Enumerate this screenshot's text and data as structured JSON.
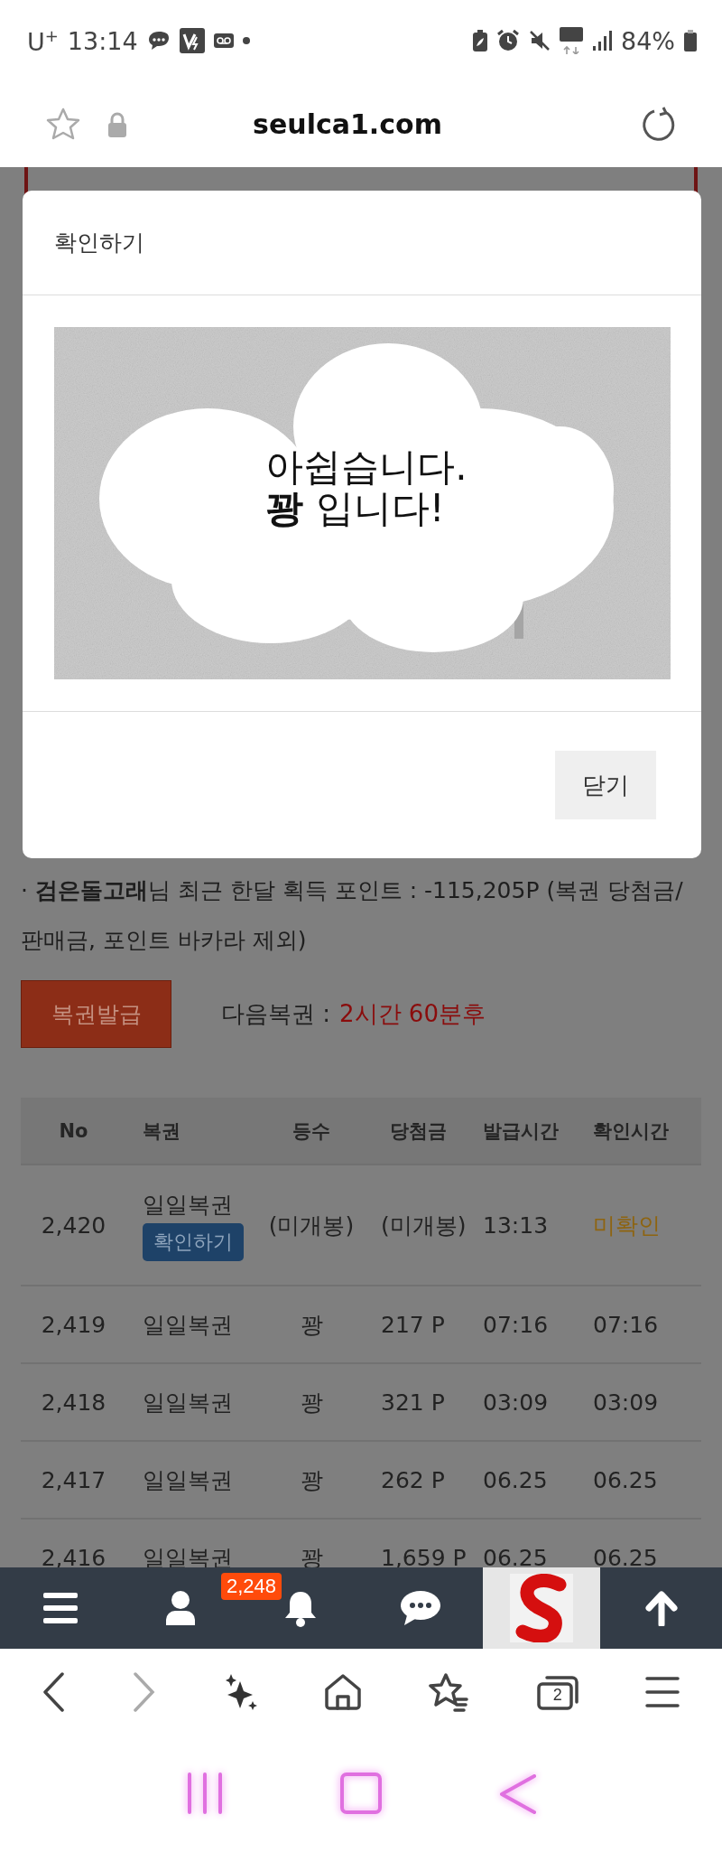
{
  "status_bar": {
    "carrier": "U$^{+}$",
    "time": "13:14",
    "battery": "84%"
  },
  "address_bar": {
    "url": "seulca1.com"
  },
  "dialog": {
    "title": "확인하기",
    "message_lines": [
      "아쉽습니다.",
      "**꽝** 입니다!"
    ],
    "close_button": "닫기"
  },
  "summary": "· **검은돌고래**님 최근 한달 획득 포인트 : -115,205P (복권 당첨금/판매금, 포인트 바카라 제외)",
  "issue_button": "복권발급",
  "next_lottery": {
    "label": "다음복권 :",
    "value": "2시간 60분후"
  },
  "table": {
    "columns": [
      "No",
      "복권",
      "등수",
      "당첨금",
      "발급시간",
      "확인시간"
    ],
    "rows": [
      {
        "cells": [
          "2,420",
          "일일복권",
          "(미개봉)",
          "(미개봉)",
          "13:13",
          "미확인"
        ],
        "action": "확인하기",
        "confirmed": false
      },
      {
        "cells": [
          "2,419",
          "일일복권",
          "꽝",
          "217 P",
          "07:16",
          "07:16"
        ],
        "confirmed": true
      },
      {
        "cells": [
          "2,418",
          "일일복권",
          "꽝",
          "321 P",
          "03:09",
          "03:09"
        ],
        "confirmed": true
      },
      {
        "cells": [
          "2,417",
          "일일복권",
          "꽝",
          "262 P",
          "06.25",
          "06.25"
        ],
        "confirmed": true
      },
      {
        "cells": [
          "2,416",
          "일일복권",
          "꽝",
          "1,659 P",
          "06.25",
          "06.25"
        ],
        "confirmed": true
      }
    ]
  },
  "bottom_nav": {
    "notification_count": "2,248"
  },
  "browser_toolbar": {
    "tab_count": "2"
  }
}
